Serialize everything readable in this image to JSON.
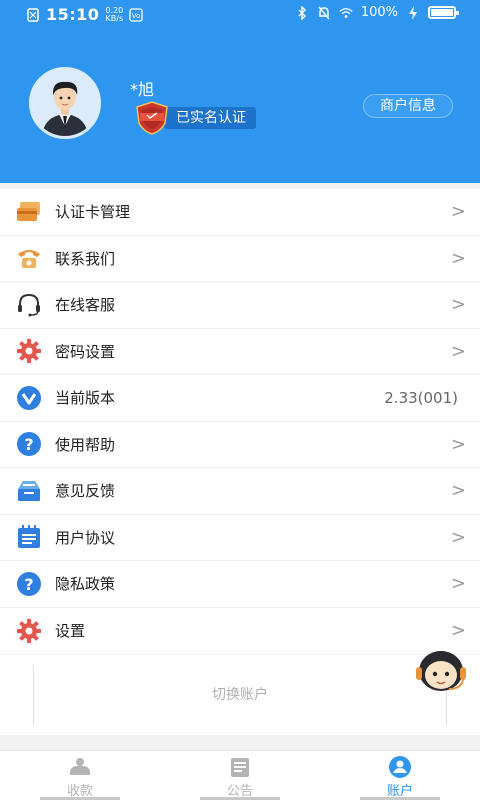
{
  "statusbar": {
    "time": "15:10",
    "speed_value": "0.20",
    "speed_unit": "KB/s",
    "battery_text": "100%",
    "battery_level": 1.0
  },
  "profile": {
    "username": "*旭",
    "verify_text": "已实名认证",
    "merchant_button": "商户信息"
  },
  "menu": [
    {
      "label": "认证卡管理",
      "icon": "card-icon",
      "chevron": ">"
    },
    {
      "label": "联系我们",
      "icon": "phone-icon",
      "chevron": ">"
    },
    {
      "label": "在线客服",
      "icon": "headset-icon",
      "chevron": ">"
    },
    {
      "label": "密码设置",
      "icon": "gear-icon",
      "chevron": ">"
    },
    {
      "label": "当前版本",
      "icon": "version-icon",
      "value": "2.33(001)"
    },
    {
      "label": "使用帮助",
      "icon": "help-icon",
      "chevron": ">"
    },
    {
      "label": "意见反馈",
      "icon": "feedback-icon",
      "chevron": ">"
    },
    {
      "label": "用户协议",
      "icon": "agreement-icon",
      "chevron": ">"
    },
    {
      "label": "隐私政策",
      "icon": "privacy-icon",
      "chevron": ">"
    },
    {
      "label": "设置",
      "icon": "settings-icon",
      "chevron": ">"
    }
  ],
  "switch_account": "切换账户",
  "tabs": [
    {
      "label": "收款",
      "icon": "collect-icon",
      "active": false
    },
    {
      "label": "公告",
      "icon": "notice-icon",
      "active": false
    },
    {
      "label": "账户",
      "icon": "account-icon",
      "active": true
    }
  ],
  "colors": {
    "primary": "#2f96f0",
    "icon_orange": "#e8943a",
    "icon_red": "#e2584d",
    "icon_blue": "#2f7fe0"
  }
}
